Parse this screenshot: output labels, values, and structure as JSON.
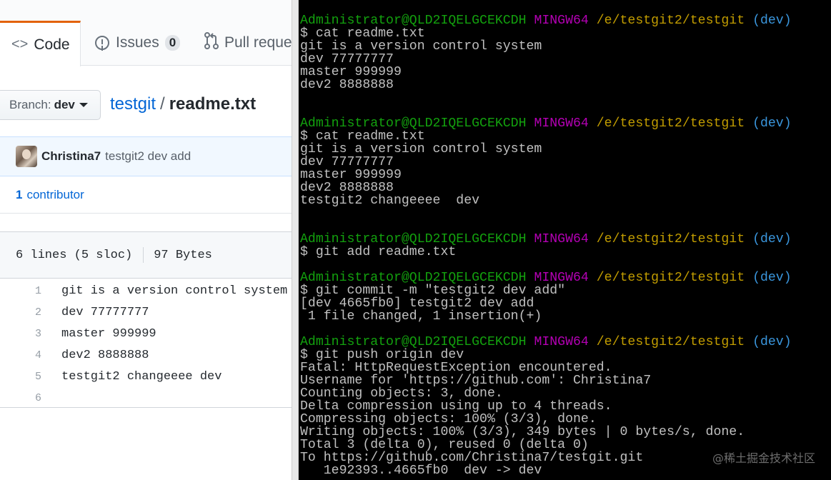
{
  "github": {
    "tabs": {
      "code": {
        "label": "Code",
        "icon": "code-icon"
      },
      "issues": {
        "label": "Issues",
        "count": "0",
        "icon": "issue-opened-icon"
      },
      "pulls": {
        "label": "Pull reque",
        "icon": "git-pull-request-icon"
      }
    },
    "branch": {
      "prefix": "Branch:",
      "name": "dev"
    },
    "breadcrumb": {
      "repo": "testgit",
      "separator": "/",
      "file": "readme.txt"
    },
    "commit": {
      "author": "Christina7",
      "message": "testgit2 dev add"
    },
    "contributors": {
      "count": "1",
      "label": "contributor"
    },
    "file_info": {
      "lines": "6 lines (5 sloc)",
      "size": "97 Bytes"
    },
    "code_lines": [
      {
        "num": "1",
        "text": "git is a version control system"
      },
      {
        "num": "2",
        "text": "dev 77777777"
      },
      {
        "num": "3",
        "text": "master 999999"
      },
      {
        "num": "4",
        "text": "dev2 8888888"
      },
      {
        "num": "5",
        "text": "testgit2 changeeee  dev"
      },
      {
        "num": "6",
        "text": ""
      }
    ]
  },
  "terminal": {
    "prompt": {
      "user": "Administrator@QLD2IQELGCEKCDH",
      "system": "MINGW64",
      "path": "/e/testgit2/testgit",
      "branch": "(dev)"
    },
    "lines": [
      {
        "type": "prompt"
      },
      {
        "type": "text",
        "text": "$ cat readme.txt"
      },
      {
        "type": "text",
        "text": "git is a version control system"
      },
      {
        "type": "text",
        "text": "dev 77777777"
      },
      {
        "type": "text",
        "text": "master 999999"
      },
      {
        "type": "text",
        "text": "dev2 8888888"
      },
      {
        "type": "blank"
      },
      {
        "type": "blank"
      },
      {
        "type": "prompt"
      },
      {
        "type": "text",
        "text": "$ cat readme.txt"
      },
      {
        "type": "text",
        "text": "git is a version control system"
      },
      {
        "type": "text",
        "text": "dev 77777777"
      },
      {
        "type": "text",
        "text": "master 999999"
      },
      {
        "type": "text",
        "text": "dev2 8888888"
      },
      {
        "type": "text",
        "text": "testgit2 changeeee  dev"
      },
      {
        "type": "blank"
      },
      {
        "type": "blank"
      },
      {
        "type": "prompt"
      },
      {
        "type": "text",
        "text": "$ git add readme.txt"
      },
      {
        "type": "blank"
      },
      {
        "type": "prompt"
      },
      {
        "type": "text",
        "text": "$ git commit -m \"testgit2 dev add\""
      },
      {
        "type": "text",
        "text": "[dev 4665fb0] testgit2 dev add"
      },
      {
        "type": "text",
        "text": " 1 file changed, 1 insertion(+)"
      },
      {
        "type": "blank"
      },
      {
        "type": "prompt"
      },
      {
        "type": "text",
        "text": "$ git push origin dev"
      },
      {
        "type": "text",
        "text": "Fatal: HttpRequestException encountered."
      },
      {
        "type": "text",
        "text": "Username for 'https://github.com': Christina7"
      },
      {
        "type": "text",
        "text": "Counting objects: 3, done."
      },
      {
        "type": "text",
        "text": "Delta compression using up to 4 threads."
      },
      {
        "type": "text",
        "text": "Compressing objects: 100% (3/3), done."
      },
      {
        "type": "text",
        "text": "Writing objects: 100% (3/3), 349 bytes | 0 bytes/s, done."
      },
      {
        "type": "text",
        "text": "Total 3 (delta 0), reused 0 (delta 0)"
      },
      {
        "type": "text",
        "text": "To https://github.com/Christina7/testgit.git"
      },
      {
        "type": "text",
        "text": "   1e92393..4665fb0  dev -> dev"
      }
    ],
    "watermark": "@稀土掘金技术社区"
  },
  "colors": {
    "prompt_user": "#13a10e",
    "prompt_system": "#b400b4",
    "prompt_path": "#c19c00",
    "prompt_branch": "#3a96dd",
    "terminal_text": "#c0c0c0",
    "link": "#0366d6",
    "tab_accent": "#e36209"
  }
}
